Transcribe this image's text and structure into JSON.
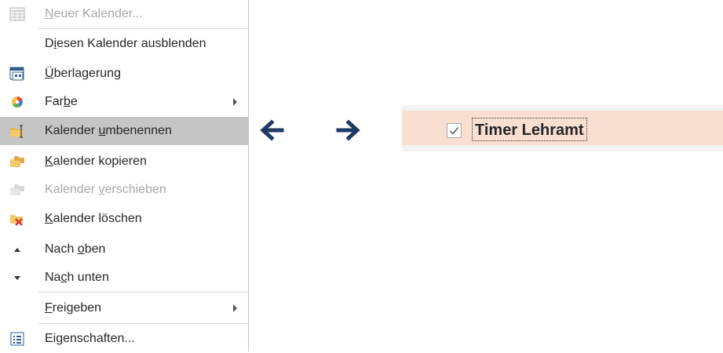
{
  "menu": {
    "items": [
      {
        "label_pre": "",
        "label_u": "N",
        "label_post": "euer Kalender...",
        "icon": "calendar-grid-icon",
        "disabled": true
      },
      {
        "label_pre": "D",
        "label_u": "i",
        "label_post": "esen Kalender ausblenden",
        "icon": "",
        "disabled": false
      },
      {
        "label_pre": "",
        "label_u": "Ü",
        "label_post": "berlagerung",
        "icon": "overlay-calendar-icon",
        "disabled": false
      },
      {
        "label_pre": "Far",
        "label_u": "b",
        "label_post": "e",
        "icon": "color-palette-icon",
        "disabled": false,
        "submenu": true
      },
      {
        "label_pre": "Kalender ",
        "label_u": "u",
        "label_post": "mbenennen",
        "icon": "rename-folder-icon",
        "disabled": false,
        "highlighted": true
      },
      {
        "label_pre": "",
        "label_u": "K",
        "label_post": "alender kopieren",
        "icon": "copy-folder-icon",
        "disabled": false
      },
      {
        "label_pre": "Kalender ",
        "label_u": "v",
        "label_post": "erschieben",
        "icon": "move-folder-icon",
        "disabled": true
      },
      {
        "label_pre": "",
        "label_u": "K",
        "label_post": "alender löschen",
        "icon": "delete-folder-icon",
        "disabled": false
      },
      {
        "label_pre": "Nach ",
        "label_u": "o",
        "label_post": "ben",
        "icon": "move-up-icon",
        "disabled": false
      },
      {
        "label_pre": "Na",
        "label_u": "c",
        "label_post": "h unten",
        "icon": "move-down-icon",
        "disabled": false
      },
      {
        "label_pre": "",
        "label_u": "F",
        "label_post": "reigeben",
        "icon": "",
        "disabled": false,
        "submenu": true
      },
      {
        "label_pre": "Eigenschaften...",
        "label_u": "",
        "label_post": "",
        "icon": "properties-icon",
        "disabled": false
      }
    ]
  },
  "arrows": {
    "left": "arrow-left-icon",
    "right": "arrow-right-icon"
  },
  "calendar_item": {
    "name": "Timer Lehramt",
    "checked": true,
    "check_glyph": "✓"
  },
  "colors": {
    "highlight": "#c5c5c5",
    "calendar_band": "#f8dfd1",
    "arrow": "#1f3864"
  }
}
